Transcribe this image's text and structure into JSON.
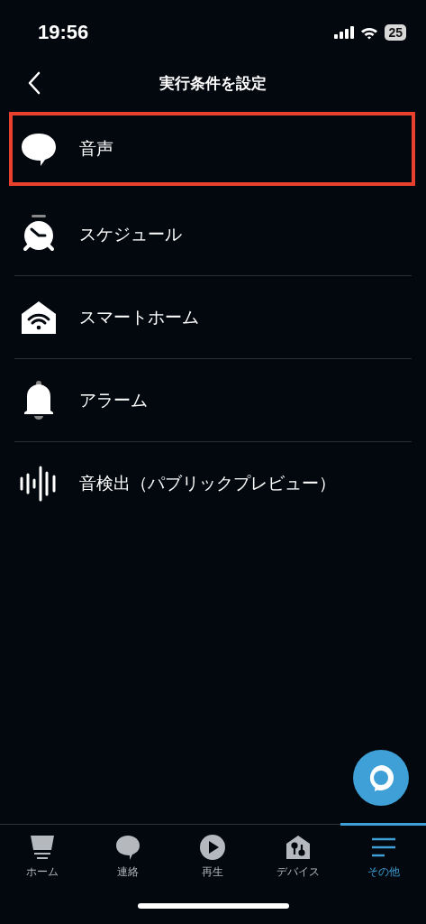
{
  "status_bar": {
    "time": "19:56",
    "battery": "25"
  },
  "header": {
    "title": "実行条件を設定"
  },
  "items": [
    {
      "label": "音声",
      "kind": "speech",
      "highlighted": true
    },
    {
      "label": "スケジュール",
      "kind": "clock",
      "highlighted": false
    },
    {
      "label": "スマートホーム",
      "kind": "smarthome",
      "highlighted": false
    },
    {
      "label": "アラーム",
      "kind": "bell",
      "highlighted": false
    },
    {
      "label": "音検出（パブリックプレビュー）",
      "kind": "wave",
      "highlighted": false
    }
  ],
  "tabs": [
    {
      "label": "ホーム",
      "kind": "home",
      "selected": false
    },
    {
      "label": "連絡",
      "kind": "chat",
      "selected": false
    },
    {
      "label": "再生",
      "kind": "play",
      "selected": false
    },
    {
      "label": "デバイス",
      "kind": "devices",
      "selected": false
    },
    {
      "label": "その他",
      "kind": "more",
      "selected": true
    }
  ]
}
